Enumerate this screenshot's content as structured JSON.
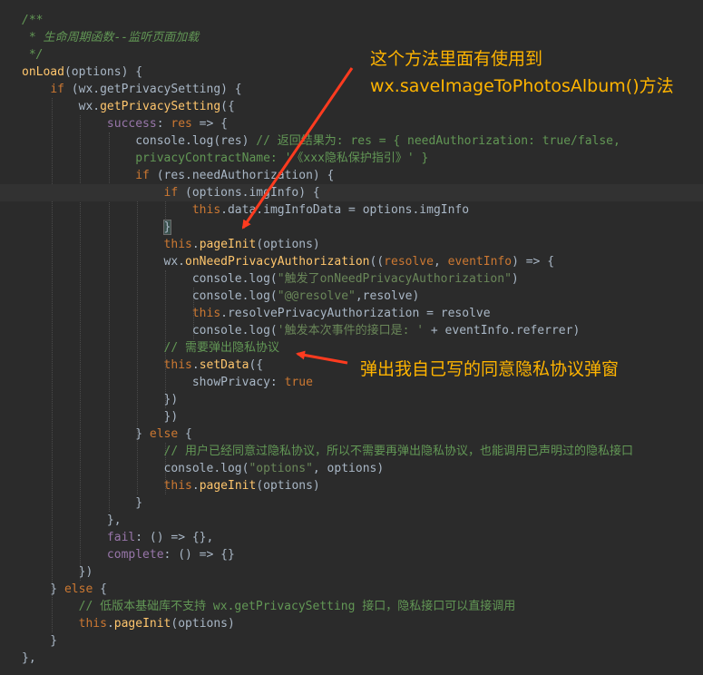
{
  "editor": {
    "colors": {
      "background": "#2b2b2b",
      "keyword": "#cc7832",
      "function": "#ffc66d",
      "string": "#6a8759",
      "comment": "#629755",
      "property": "#9876aa",
      "plain": "#a9b7c6",
      "annotation": "#ffb400",
      "arrow": "#ff3b1f"
    },
    "lines": [
      [
        [
          "jdoc",
          "/**"
        ]
      ],
      [
        [
          "jdoc",
          " * 生命周期函数--监听页面加载"
        ]
      ],
      [
        [
          "jdoc",
          " */"
        ]
      ],
      [
        [
          "fn",
          "onLoad"
        ],
        [
          "plain",
          "(options) {"
        ]
      ],
      [
        [
          "plain",
          "    "
        ],
        [
          "kw",
          "if"
        ],
        [
          "plain",
          " (wx.getPrivacySetting) {"
        ]
      ],
      [
        [
          "plain",
          "        wx."
        ],
        [
          "fn",
          "getPrivacySetting"
        ],
        [
          "plain",
          "({"
        ]
      ],
      [
        [
          "plain",
          "            "
        ],
        [
          "prop",
          "success"
        ],
        [
          "plain",
          ": "
        ],
        [
          "kw",
          "res"
        ],
        [
          "plain",
          " => {"
        ]
      ],
      [
        [
          "plain",
          "                console.log(res) "
        ],
        [
          "cm",
          "// 返回结果为: res = { needAuthorization: true/false,"
        ]
      ],
      [
        [
          "cm",
          "                privacyContractName: '《xxx隐私保护指引》' }"
        ]
      ],
      [
        [
          "plain",
          "                "
        ],
        [
          "kw",
          "if"
        ],
        [
          "plain",
          " (res.needAuthorization) {"
        ]
      ],
      [
        [
          "plain",
          "                    "
        ],
        [
          "kw",
          "if"
        ],
        [
          "plain",
          " (options.imgInfo) {"
        ]
      ],
      [
        [
          "plain",
          "                        "
        ],
        [
          "kw",
          "this"
        ],
        [
          "plain",
          ".data.imgInfoData = options.imgInfo"
        ]
      ],
      [
        [
          "plain",
          "                    "
        ],
        [
          "hl",
          "}"
        ]
      ],
      [
        [
          "plain",
          "                    "
        ],
        [
          "kw",
          "this"
        ],
        [
          "plain",
          "."
        ],
        [
          "fn",
          "pageInit"
        ],
        [
          "plain",
          "(options)"
        ]
      ],
      [
        [
          "plain",
          "                    wx."
        ],
        [
          "fn",
          "onNeedPrivacyAuthorization"
        ],
        [
          "plain",
          "(("
        ],
        [
          "kw",
          "resolve"
        ],
        [
          "plain",
          ", "
        ],
        [
          "kw",
          "eventInfo"
        ],
        [
          "plain",
          ") => {"
        ]
      ],
      [
        [
          "plain",
          "                        console.log("
        ],
        [
          "str",
          "\"触发了onNeedPrivacyAuthorization\""
        ],
        [
          "plain",
          ")"
        ]
      ],
      [
        [
          "plain",
          "                        console.log("
        ],
        [
          "str",
          "\"@@resolve\""
        ],
        [
          "plain",
          ",resolve)"
        ]
      ],
      [
        [
          "plain",
          "                        "
        ],
        [
          "kw",
          "this"
        ],
        [
          "plain",
          ".resolvePrivacyAuthorization = resolve"
        ]
      ],
      [
        [
          "plain",
          "                        console.log("
        ],
        [
          "str",
          "'触发本次事件的接口是: '"
        ],
        [
          "plain",
          " + eventInfo.referrer)"
        ]
      ],
      [
        [
          "cm",
          "                    // 需要弹出隐私协议"
        ]
      ],
      [
        [
          "plain",
          "                    "
        ],
        [
          "kw",
          "this"
        ],
        [
          "plain",
          "."
        ],
        [
          "fn",
          "setData"
        ],
        [
          "plain",
          "({"
        ]
      ],
      [
        [
          "plain",
          "                        showPrivacy: "
        ],
        [
          "kw",
          "true"
        ]
      ],
      [
        [
          "plain",
          "                    })"
        ]
      ],
      [
        [
          "plain",
          "                    })"
        ]
      ],
      [
        [
          "plain",
          "                } "
        ],
        [
          "kw",
          "else"
        ],
        [
          "plain",
          " {"
        ]
      ],
      [
        [
          "cm",
          "                    // 用户已经同意过隐私协议，所以不需要再弹出隐私协议，也能调用已声明过的隐私接口"
        ]
      ],
      [
        [
          "plain",
          "                    console.log("
        ],
        [
          "str",
          "\"options\""
        ],
        [
          "plain",
          ", options)"
        ]
      ],
      [
        [
          "plain",
          "                    "
        ],
        [
          "kw",
          "this"
        ],
        [
          "plain",
          "."
        ],
        [
          "fn",
          "pageInit"
        ],
        [
          "plain",
          "(options)"
        ]
      ],
      [
        [
          "plain",
          "                }"
        ]
      ],
      [
        [
          "plain",
          "            },"
        ]
      ],
      [
        [
          "plain",
          "            "
        ],
        [
          "prop",
          "fail"
        ],
        [
          "plain",
          ": () => {},"
        ]
      ],
      [
        [
          "plain",
          "            "
        ],
        [
          "prop",
          "complete"
        ],
        [
          "plain",
          ": () => {}"
        ]
      ],
      [
        [
          "plain",
          "        })"
        ]
      ],
      [
        [
          "plain",
          "    } "
        ],
        [
          "kw",
          "else"
        ],
        [
          "plain",
          " {"
        ]
      ],
      [
        [
          "cm",
          "        // 低版本基础库不支持 wx.getPrivacySetting 接口，隐私接口可以直接调用"
        ]
      ],
      [
        [
          "plain",
          "        "
        ],
        [
          "kw",
          "this"
        ],
        [
          "plain",
          "."
        ],
        [
          "fn",
          "pageInit"
        ],
        [
          "plain",
          "(options)"
        ]
      ],
      [
        [
          "plain",
          "    }"
        ]
      ],
      [
        [
          "plain",
          "},"
        ]
      ]
    ]
  },
  "annotations": {
    "top_line1": "这个方法里面有使用到",
    "top_line2": "wx.saveImageToPhotosAlbum()方法",
    "middle": "弹出我自己写的同意隐私协议弹窗"
  }
}
